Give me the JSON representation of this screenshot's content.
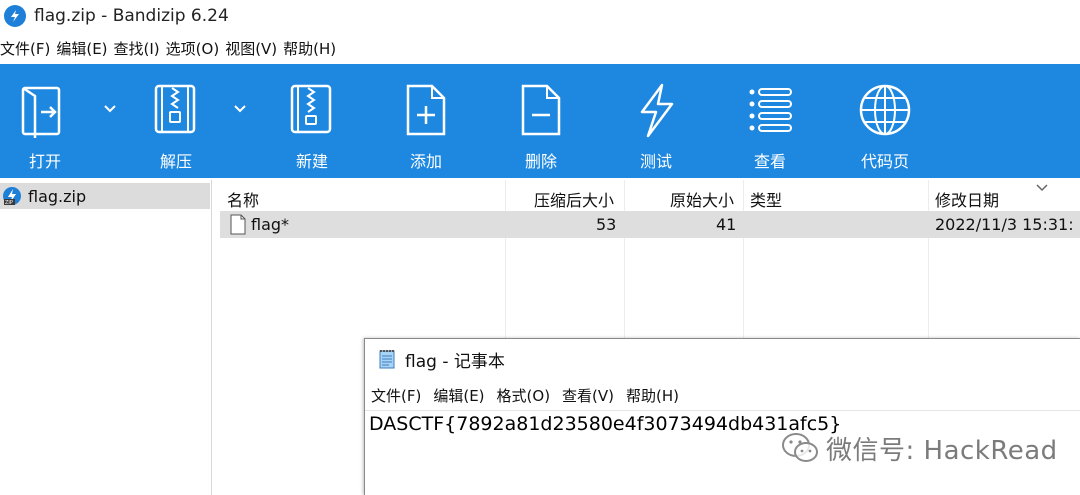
{
  "window": {
    "title": "flag.zip - Bandizip 6.24"
  },
  "menubar": {
    "items": [
      "文件(F)",
      "编辑(E)",
      "查找(I)",
      "选项(O)",
      "视图(V)",
      "帮助(H)"
    ]
  },
  "toolbar": {
    "background": "#1e88e0",
    "buttons": [
      {
        "label": "打开",
        "icon": "open-icon"
      },
      {
        "label": "解压",
        "icon": "extract-icon"
      },
      {
        "label": "新建",
        "icon": "new-archive-icon"
      },
      {
        "label": "添加",
        "icon": "add-file-icon"
      },
      {
        "label": "删除",
        "icon": "delete-file-icon"
      },
      {
        "label": "测试",
        "icon": "test-lightning-icon"
      },
      {
        "label": "查看",
        "icon": "view-list-icon"
      },
      {
        "label": "代码页",
        "icon": "codepage-globe-icon"
      }
    ]
  },
  "tree": {
    "items": [
      {
        "label": "flag.zip",
        "icon": "zip-archive-icon"
      }
    ]
  },
  "filelist": {
    "columns": [
      "名称",
      "压缩后大小",
      "原始大小",
      "类型",
      "修改日期"
    ],
    "rows": [
      {
        "name": "flag*",
        "compressed": "53",
        "original": "41",
        "type": "",
        "modified": "2022/11/3 15:31:"
      }
    ]
  },
  "notepad": {
    "title": "flag - 记事本",
    "menu": [
      "文件(F)",
      "编辑(E)",
      "格式(O)",
      "查看(V)",
      "帮助(H)"
    ],
    "content": "DASCTF{7892a81d23580e4f3073494db431afc5}"
  },
  "watermark": {
    "text": "微信号: HackRead",
    "icon": "wechat-icon"
  }
}
